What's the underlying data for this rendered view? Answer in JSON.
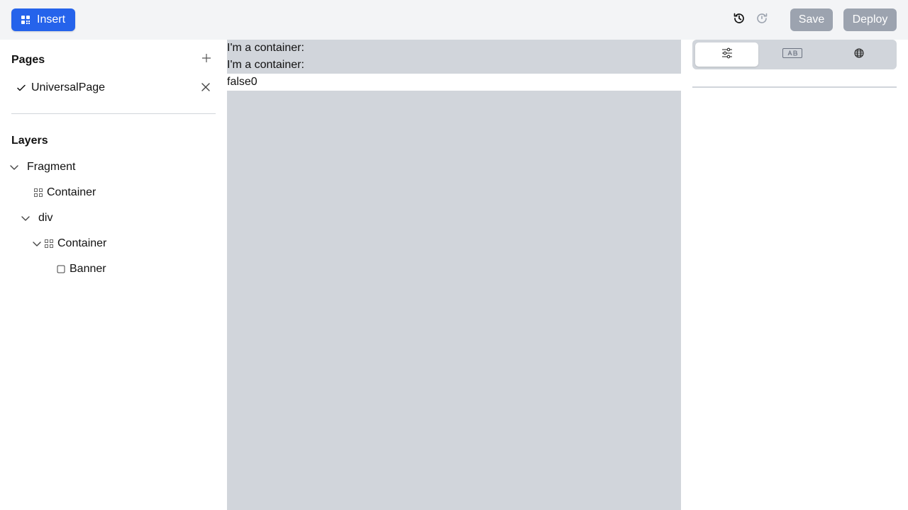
{
  "toolbar": {
    "insert_label": "Insert",
    "save_label": "Save",
    "deploy_label": "Deploy"
  },
  "colors": {
    "accent": "#2563eb",
    "topbar_bg": "#f3f4f6",
    "canvas_bg": "#d1d5db",
    "disabled_button": "#9ca3af"
  },
  "sidebar": {
    "pages_title": "Pages",
    "pages": [
      {
        "label": "UniversalPage",
        "selected": true
      }
    ],
    "layers_title": "Layers",
    "layers": [
      {
        "label": "Fragment",
        "icon": "chevron-down-icon",
        "expanded": true
      },
      {
        "label": "Container",
        "icon": "container-icon"
      },
      {
        "label": "div",
        "icon": "chevron-down-icon",
        "expanded": true
      },
      {
        "label": "Container",
        "icon": "container-icon",
        "expanded": true
      },
      {
        "label": "Banner",
        "icon": "checkbox-icon"
      }
    ]
  },
  "canvas": {
    "lines": [
      "I'm a container:",
      "I'm a container:",
      "false0"
    ]
  },
  "right_panel": {
    "tabs": [
      {
        "icon": "sliders-icon",
        "active": true
      },
      {
        "icon": "text-field-icon",
        "active": false
      },
      {
        "icon": "globe-icon",
        "active": false
      }
    ]
  }
}
